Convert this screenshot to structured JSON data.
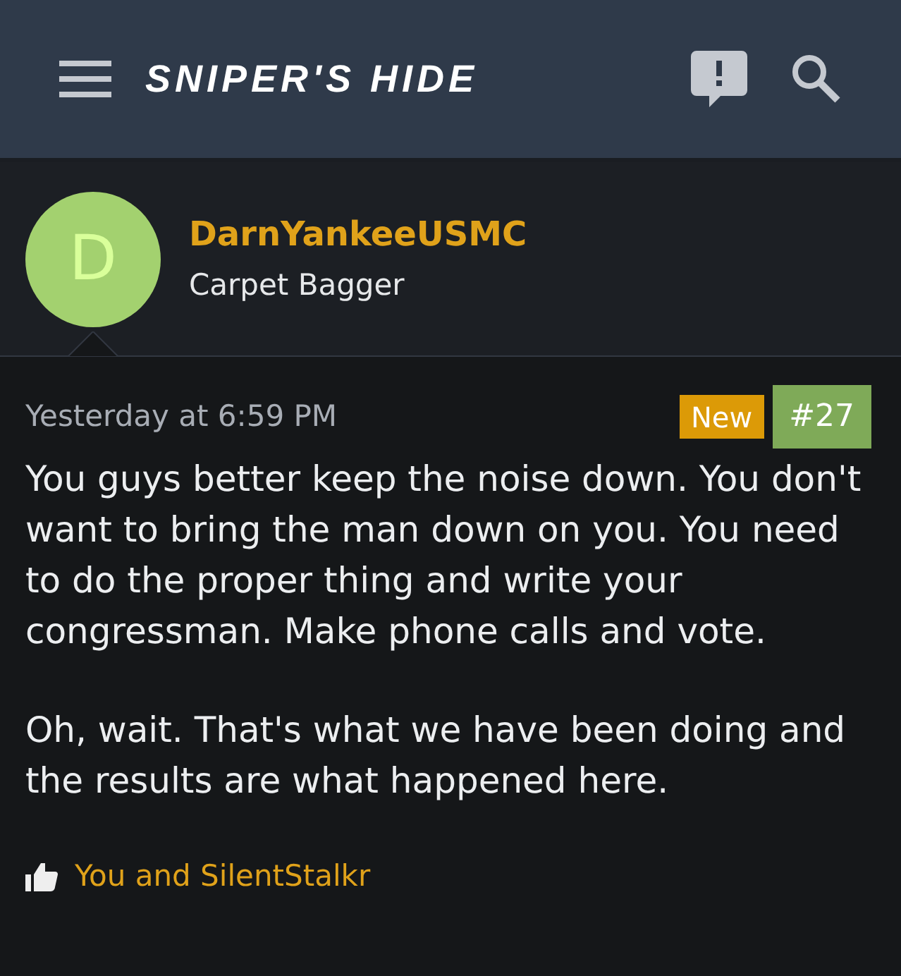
{
  "header": {
    "logo": "SNIPER'S HIDE"
  },
  "post": {
    "avatar_letter": "D",
    "username": "DarnYankeeUSMC",
    "user_title": "Carpet Bagger",
    "time": "Yesterday at 6:59 PM",
    "badges": [
      {
        "kind": "new",
        "label": "New"
      },
      {
        "kind": "number",
        "label": "#27"
      }
    ],
    "paragraphs": [
      "You guys better keep the noise down. You don't want to bring the man down on you. You need to do the proper thing and write your congressman. Make phone calls and vote.",
      "Oh, wait. That's what we have been doing and the results are what happened here."
    ],
    "likes": "You and SilentStalkr"
  }
}
